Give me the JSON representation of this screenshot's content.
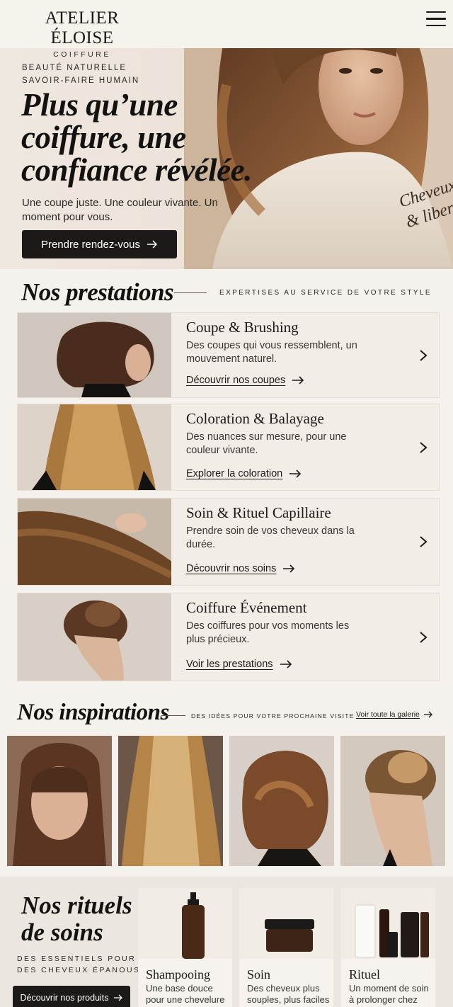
{
  "brand": {
    "name": "ATELIER ÉLOISE",
    "tagline": "COIFFURE"
  },
  "hero": {
    "kicker_1": "BEAUTÉ NATURELLE",
    "kicker_2": "SAVOIR-FAIRE HUMAIN",
    "title": "Plus qu’une coiffure, une confiance révélée.",
    "text": "Une coupe juste. Une couleur vivante. Un moment pour vous.",
    "cta": "Prendre rendez-vous",
    "script_text": "Cheveux & liberté"
  },
  "prestations": {
    "title": "Nos prestations",
    "kicker": "EXPERTISES AU SERVICE DE VOTRE STYLE",
    "items": [
      {
        "title": "Coupe & Brushing",
        "desc": "Des coupes qui vous ressemblent, un mouvement naturel.",
        "link": "Découvrir nos coupes"
      },
      {
        "title": "Coloration & Balayage",
        "desc": "Des nuances sur mesure, pour une couleur vivante.",
        "link": "Explorer la coloration"
      },
      {
        "title": "Soin & Rituel Capillaire",
        "desc": "Prendre soin de vos cheveux dans la durée.",
        "link": "Découvrir nos soins"
      },
      {
        "title": "Coiffure Événement",
        "desc": "Des coiffures pour vos moments les plus précieux.",
        "link": "Voir les prestations"
      }
    ]
  },
  "inspirations": {
    "title": "Nos inspirations",
    "kicker": "DES IDÉES POUR VOTRE PROCHAINE VISITE",
    "link": "Voir toute la galerie"
  },
  "rituels": {
    "title_1": "Nos rituels",
    "title_2": "de soins",
    "kicker_1": "DES ESSENTIELS POUR",
    "kicker_2": "DES CHEVEUX ÉPANOUS",
    "cta": "Découvrir nos produits",
    "products": [
      {
        "name": "Shampooing",
        "desc": "Une base douce pour une chevelure"
      },
      {
        "name": "Soin",
        "desc": "Des cheveux plus souples, plus faciles"
      },
      {
        "name": "Rituel",
        "desc": "Un moment de soin à prolonger chez"
      }
    ]
  },
  "colors": {
    "ink": "#1c1a18",
    "background": "#f5f1ec",
    "card": "#f2ede7"
  }
}
